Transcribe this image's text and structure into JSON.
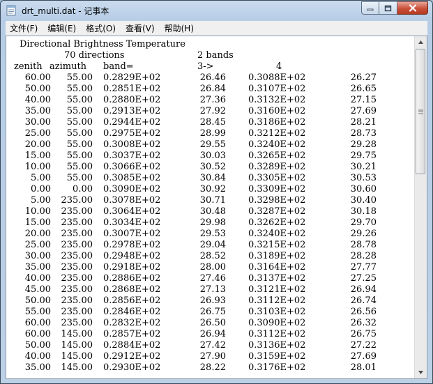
{
  "window": {
    "title": "drt_multi.dat - 记事本"
  },
  "menu": [
    {
      "id": "file",
      "label": "文件(F)"
    },
    {
      "id": "edit",
      "label": "编辑(E)"
    },
    {
      "id": "format",
      "label": "格式(O)"
    },
    {
      "id": "view",
      "label": "查看(V)"
    },
    {
      "id": "help",
      "label": "帮助(H)"
    }
  ],
  "document": {
    "header": {
      "title": "Directional Brightness Temperature",
      "directions": "70 directions",
      "bands": "2 bands",
      "col_zenith": "zenith",
      "col_azimuth": "azimuth",
      "col_band": "band=",
      "arrow": "3->",
      "band_num": "4"
    },
    "rows": [
      [
        "60.00",
        "55.00",
        "0.2829E+02",
        "26.46",
        "0.3088E+02",
        "26.27"
      ],
      [
        "50.00",
        "55.00",
        "0.2851E+02",
        "26.84",
        "0.3107E+02",
        "26.65"
      ],
      [
        "40.00",
        "55.00",
        "0.2880E+02",
        "27.36",
        "0.3132E+02",
        "27.15"
      ],
      [
        "35.00",
        "55.00",
        "0.2913E+02",
        "27.92",
        "0.3160E+02",
        "27.69"
      ],
      [
        "30.00",
        "55.00",
        "0.2944E+02",
        "28.45",
        "0.3186E+02",
        "28.21"
      ],
      [
        "25.00",
        "55.00",
        "0.2975E+02",
        "28.99",
        "0.3212E+02",
        "28.73"
      ],
      [
        "20.00",
        "55.00",
        "0.3008E+02",
        "29.55",
        "0.3240E+02",
        "29.28"
      ],
      [
        "15.00",
        "55.00",
        "0.3037E+02",
        "30.03",
        "0.3265E+02",
        "29.75"
      ],
      [
        "10.00",
        "55.00",
        "0.3066E+02",
        "30.52",
        "0.3289E+02",
        "30.21"
      ],
      [
        "5.00",
        "55.00",
        "0.3085E+02",
        "30.84",
        "0.3305E+02",
        "30.53"
      ],
      [
        "0.00",
        "0.00",
        "0.3090E+02",
        "30.92",
        "0.3309E+02",
        "30.60"
      ],
      [
        "5.00",
        "235.00",
        "0.3078E+02",
        "30.71",
        "0.3298E+02",
        "30.40"
      ],
      [
        "10.00",
        "235.00",
        "0.3064E+02",
        "30.48",
        "0.3287E+02",
        "30.18"
      ],
      [
        "15.00",
        "235.00",
        "0.3034E+02",
        "29.98",
        "0.3262E+02",
        "29.70"
      ],
      [
        "20.00",
        "235.00",
        "0.3007E+02",
        "29.53",
        "0.3240E+02",
        "29.26"
      ],
      [
        "25.00",
        "235.00",
        "0.2978E+02",
        "29.04",
        "0.3215E+02",
        "28.78"
      ],
      [
        "30.00",
        "235.00",
        "0.2948E+02",
        "28.52",
        "0.3189E+02",
        "28.28"
      ],
      [
        "35.00",
        "235.00",
        "0.2918E+02",
        "28.00",
        "0.3164E+02",
        "27.77"
      ],
      [
        "40.00",
        "235.00",
        "0.2886E+02",
        "27.46",
        "0.3137E+02",
        "27.25"
      ],
      [
        "45.00",
        "235.00",
        "0.2868E+02",
        "27.13",
        "0.3121E+02",
        "26.94"
      ],
      [
        "50.00",
        "235.00",
        "0.2856E+02",
        "26.93",
        "0.3112E+02",
        "26.74"
      ],
      [
        "55.00",
        "235.00",
        "0.2846E+02",
        "26.75",
        "0.3103E+02",
        "26.56"
      ],
      [
        "60.00",
        "235.00",
        "0.2832E+02",
        "26.50",
        "0.3090E+02",
        "26.32"
      ],
      [
        "60.00",
        "145.00",
        "0.2857E+02",
        "26.94",
        "0.3112E+02",
        "26.75"
      ],
      [
        "50.00",
        "145.00",
        "0.2884E+02",
        "27.42",
        "0.3136E+02",
        "27.22"
      ],
      [
        "40.00",
        "145.00",
        "0.2912E+02",
        "27.90",
        "0.3159E+02",
        "27.69"
      ],
      [
        "35.00",
        "145.00",
        "0.2930E+02",
        "28.22",
        "0.3176E+02",
        "28.01"
      ]
    ]
  },
  "icons": {
    "app": "notepad-icon",
    "minimize": "minimize-icon",
    "maximize": "maximize-icon",
    "close": "close-icon",
    "scroll_up": "arrow-up-icon",
    "scroll_down": "arrow-down-icon",
    "grip": "grip-icon"
  },
  "colors": {
    "close_button": "#c9503a",
    "frame": "#b7cde6",
    "menubar": "#f0f0f0"
  }
}
